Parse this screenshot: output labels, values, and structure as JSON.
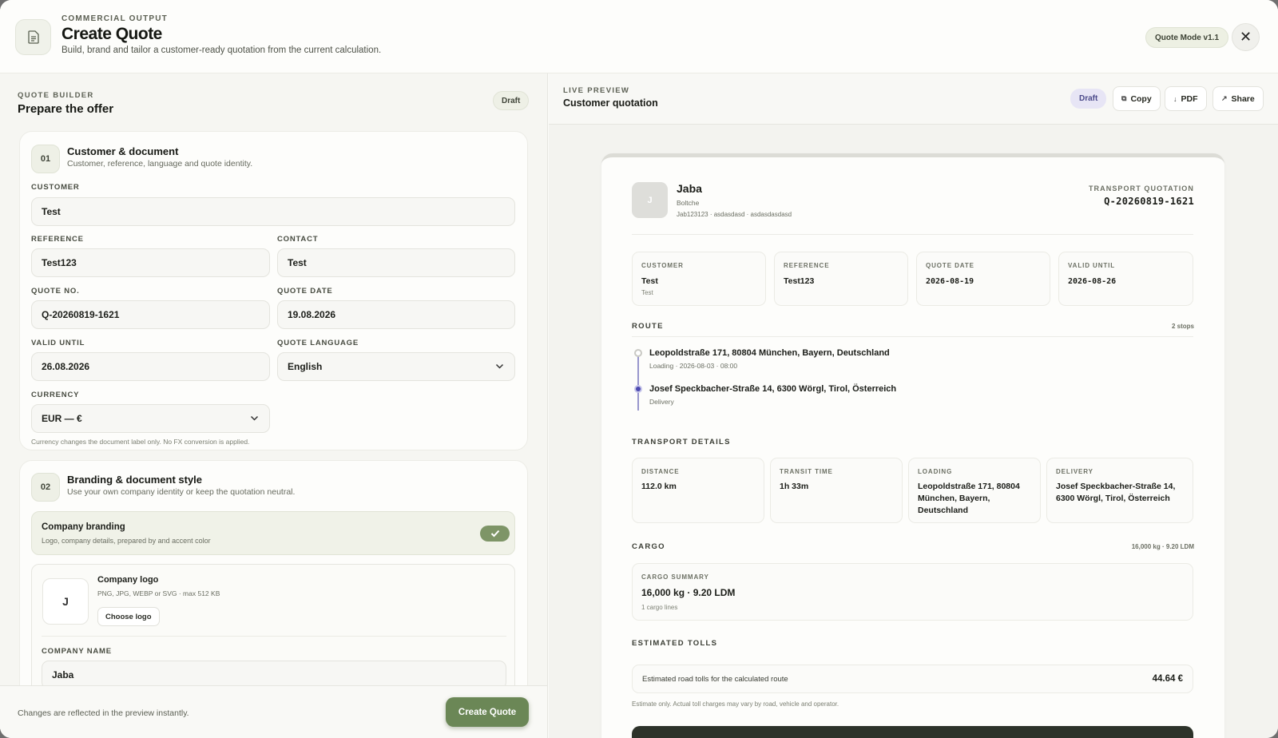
{
  "header": {
    "eyebrow": "COMMERCIAL OUTPUT",
    "title": "Create Quote",
    "subtitle": "Build, brand and tailor a customer-ready quotation from the current calculation.",
    "mode_badge": "Quote Mode v1.1",
    "close_glyph": "✕"
  },
  "builder": {
    "eyebrow": "QUOTE BUILDER",
    "title": "Prepare the offer",
    "status": "Draft",
    "section1": {
      "step": "01",
      "title": "Customer & document",
      "subtitle": "Customer, reference, language and quote identity.",
      "customer_label": "CUSTOMER",
      "customer_value": "Test",
      "reference_label": "REFERENCE",
      "reference_value": "Test123",
      "contact_label": "CONTACT",
      "contact_value": "Test",
      "quote_no_label": "QUOTE NO.",
      "quote_no_value": "Q-20260819-1621",
      "quote_date_label": "QUOTE DATE",
      "quote_date_value": "19.08.2026",
      "valid_until_label": "VALID UNTIL",
      "valid_until_value": "26.08.2026",
      "language_label": "QUOTE LANGUAGE",
      "language_value": "English",
      "currency_label": "CURRENCY",
      "currency_value": "EUR — €",
      "currency_hint": "Currency changes the document label only. No FX conversion is applied."
    },
    "section2": {
      "step": "02",
      "title": "Branding & document style",
      "subtitle": "Use your own company identity or keep the quotation neutral.",
      "branding_title": "Company branding",
      "branding_sub": "Logo, company details, prepared by and accent color",
      "branding_enabled": true,
      "logo_title": "Company logo",
      "logo_hint": "PNG, JPG, WEBP or SVG · max 512 KB",
      "logo_initial": "J",
      "choose_logo": "Choose logo",
      "company_name_label": "COMPANY NAME",
      "company_name_value": "Jaba"
    },
    "footer_text": "Changes are reflected in the preview instantly.",
    "create_button": "Create Quote"
  },
  "preview": {
    "eyebrow": "LIVE PREVIEW",
    "title": "Customer quotation",
    "status": "Draft",
    "copy": "Copy",
    "pdf": "PDF",
    "share": "Share",
    "company": {
      "initial": "J",
      "name": "Jaba",
      "sub": "Boltche",
      "meta": "Jab123123 · asdasdasd · asdasdasdasd"
    },
    "doc_type": "TRANSPORT QUOTATION",
    "quote_no": "Q-20260819-1621",
    "summary": [
      {
        "k": "CUSTOMER",
        "v": "Test",
        "s": "Test"
      },
      {
        "k": "REFERENCE",
        "v": "Test123",
        "s": ""
      },
      {
        "k": "QUOTE DATE",
        "v": "2026-08-19",
        "s": ""
      },
      {
        "k": "VALID UNTIL",
        "v": "2026-08-26",
        "s": ""
      }
    ],
    "route_title": "ROUTE",
    "route_count": "2 stops",
    "stops": [
      {
        "name": "Leopoldstraße 171, 80804 München, Bayern, Deutschland",
        "sub": "Loading · 2026-08-03 · 08:00"
      },
      {
        "name": "Josef Speckbacher-Straße 14, 6300 Wörgl, Tirol, Österreich",
        "sub": "Delivery"
      }
    ],
    "transport_title": "TRANSPORT DETAILS",
    "transport": [
      {
        "k": "DISTANCE",
        "v": "112.0 km"
      },
      {
        "k": "TRANSIT TIME",
        "v": "1h 33m"
      },
      {
        "k": "LOADING",
        "v": "Leopoldstraße 171, 80804 München, Bayern, Deutschland"
      },
      {
        "k": "DELIVERY",
        "v": "Josef Speckbacher-Straße 14, 6300 Wörgl, Tirol, Österreich"
      }
    ],
    "cargo_title": "CARGO",
    "cargo_right": "16,000 kg · 9.20 LDM",
    "cargo_summary_label": "CARGO SUMMARY",
    "cargo_summary_value": "16,000 kg · 9.20 LDM",
    "cargo_lines": "1 cargo lines",
    "tolls_title": "ESTIMATED TOLLS",
    "tolls_label": "Estimated road tolls for the calculated route",
    "tolls_value": "44.64 €",
    "tolls_hint": "Estimate only. Actual toll charges may vary by road, vehicle and operator."
  },
  "colors": {
    "accent": "#6b8756",
    "draft_badge": "#e7e5f5",
    "route_start": "#c9c9c4",
    "route_end": "#4d4ab0"
  }
}
